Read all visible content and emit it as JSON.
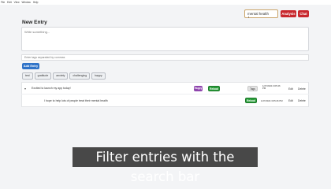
{
  "menubar": [
    "File",
    "Edit",
    "View",
    "Window",
    "Help"
  ],
  "search": {
    "value": "mental health"
  },
  "header_buttons": {
    "analysis": "Analysis",
    "chat": "Chat"
  },
  "page": {
    "title": "New Entry"
  },
  "entry_form": {
    "placeholder": "Write something...",
    "tags_placeholder": "Enter tags separated by commas",
    "add_button": "Add Entry"
  },
  "tags": [
    "test",
    "gratitude",
    "anxiety",
    "challenging",
    "happy"
  ],
  "entries": [
    {
      "text": "Excited to launch my app today!",
      "badges": [
        "Happy",
        "Reload"
      ],
      "tag": "Tags",
      "timestamp": "1/27/2024 3:05:26 PM",
      "actions": [
        "Edit",
        "Delete"
      ]
    },
    {
      "text": "I hope to help lots of people treat their mental health",
      "badges": [
        "Reload"
      ],
      "timestamp": "1/27/2024 3:05:26 PM",
      "actions": [
        "Edit",
        "Delete"
      ]
    }
  ],
  "caption": "Filter entries with the search bar",
  "colors": {
    "accent_red": "#c8272d",
    "accent_blue": "#2f73c8",
    "happy": "#8e44ad",
    "reload": "#2a9d3a"
  }
}
